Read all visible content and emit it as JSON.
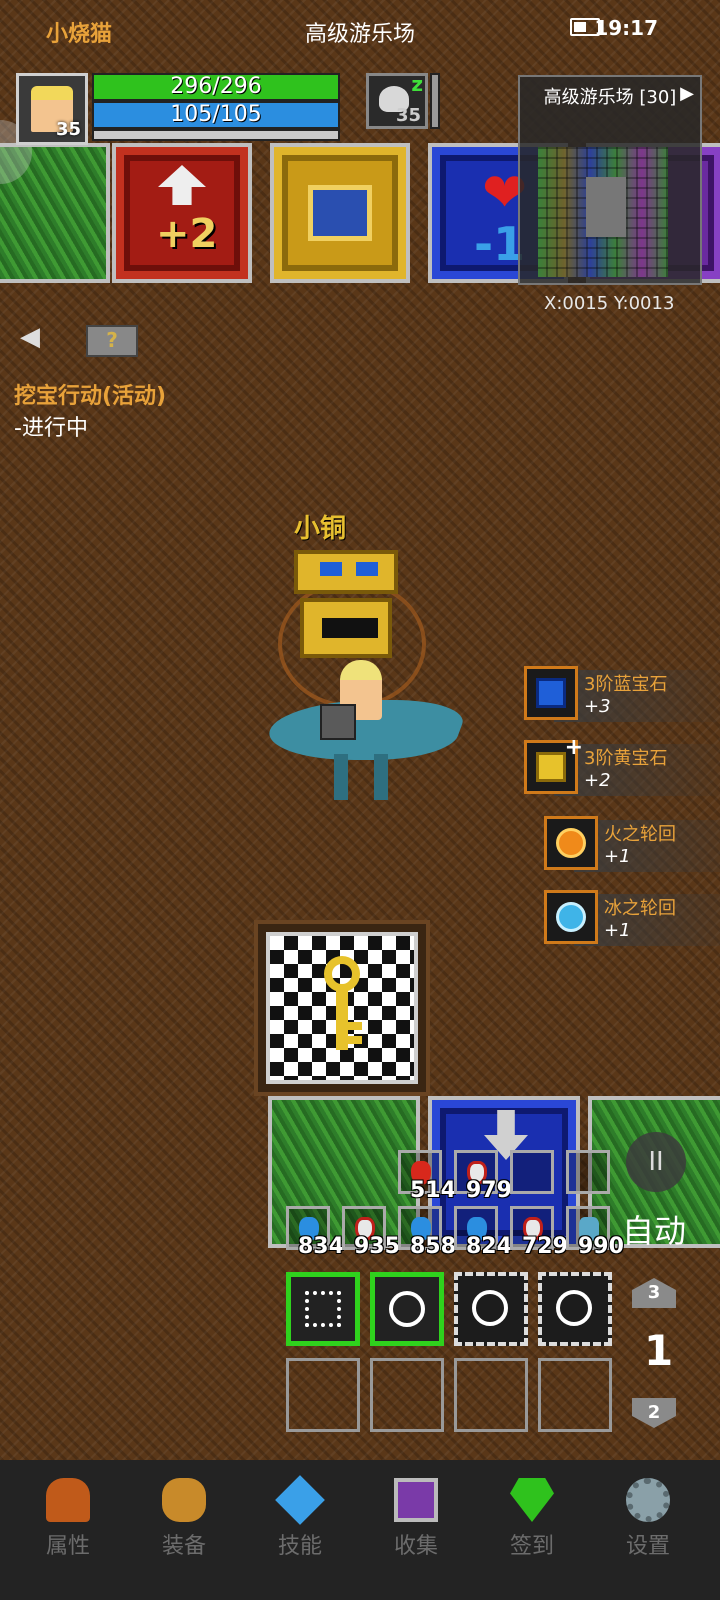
{
  "status_bar": {
    "player_name": "小烧猫",
    "location": "高级游乐场",
    "time": "19:17"
  },
  "player": {
    "level": "35",
    "hp_text": "296/296",
    "mp_text": "105/105",
    "hp_pct": 1.0,
    "mp_pct": 1.0
  },
  "enemy": {
    "level": "35",
    "status_icon": "sleep-zz-icon"
  },
  "minimap": {
    "title": "高级游乐场 [30]",
    "coords": "X:0015  Y:0013"
  },
  "quest": {
    "title": "挖宝行动(活动)",
    "status": "-进行中"
  },
  "top_tiles": [
    {
      "type": "grass"
    },
    {
      "type": "stat-up",
      "label": "+2"
    },
    {
      "type": "treasure-chest"
    },
    {
      "type": "heart",
      "label": "-1"
    },
    {
      "type": "purple"
    }
  ],
  "chest": {
    "name": "小铜"
  },
  "loot": [
    {
      "name": "3阶蓝宝石",
      "count": "+3",
      "color": "#1f5fd8",
      "icon": "blue-gem-icon"
    },
    {
      "name": "3阶黄宝石",
      "count": "+2",
      "color": "#e7c22b",
      "icon": "yellow-gem-icon"
    },
    {
      "name": "火之轮回",
      "count": "+1",
      "color": "#f08a1a",
      "icon": "fire-cycle-icon"
    },
    {
      "name": "冰之轮回",
      "count": "+1",
      "color": "#3fb4e8",
      "icon": "ice-cycle-icon"
    }
  ],
  "potions_row1": [
    {
      "count": "514",
      "icon": "red-meat-icon",
      "color": "#d8281c"
    },
    {
      "count": "979",
      "icon": "red-potion-icon",
      "color": "#e8e8e8"
    },
    {
      "count": "",
      "icon": "empty-slot"
    },
    {
      "count": "",
      "icon": "empty-slot"
    }
  ],
  "potions_row2": [
    {
      "count": "834",
      "icon": "blue-meat-icon",
      "color": "#2b8ee0"
    },
    {
      "count": "935",
      "icon": "red-potion-icon",
      "color": "#e8e8e8"
    },
    {
      "count": "858",
      "icon": "blue-meat-icon",
      "color": "#2b8ee0"
    },
    {
      "count": "824",
      "icon": "blue-meat-icon",
      "color": "#2b8ee0"
    },
    {
      "count": "729",
      "icon": "red-potion-icon",
      "color": "#e8e8e8"
    },
    {
      "count": "990",
      "icon": "blue-fish-icon",
      "color": "#5aa8c8"
    }
  ],
  "controls": {
    "pause": "II",
    "auto": "自动",
    "page_up": "3",
    "page_current": "1",
    "page_down": "2"
  },
  "nav": [
    {
      "label": "属性",
      "icon": "helmet-icon",
      "color": "#c05a1a"
    },
    {
      "label": "装备",
      "icon": "bag-icon",
      "color": "#c88a2a"
    },
    {
      "label": "技能",
      "icon": "crystal-icon",
      "color": "#3aa0e8"
    },
    {
      "label": "收集",
      "icon": "book-icon",
      "color": "#7a3aa8"
    },
    {
      "label": "签到",
      "icon": "gem-icon",
      "color": "#2fc21d"
    },
    {
      "label": "设置",
      "icon": "gear-icon",
      "color": "#8aa0a8"
    }
  ]
}
